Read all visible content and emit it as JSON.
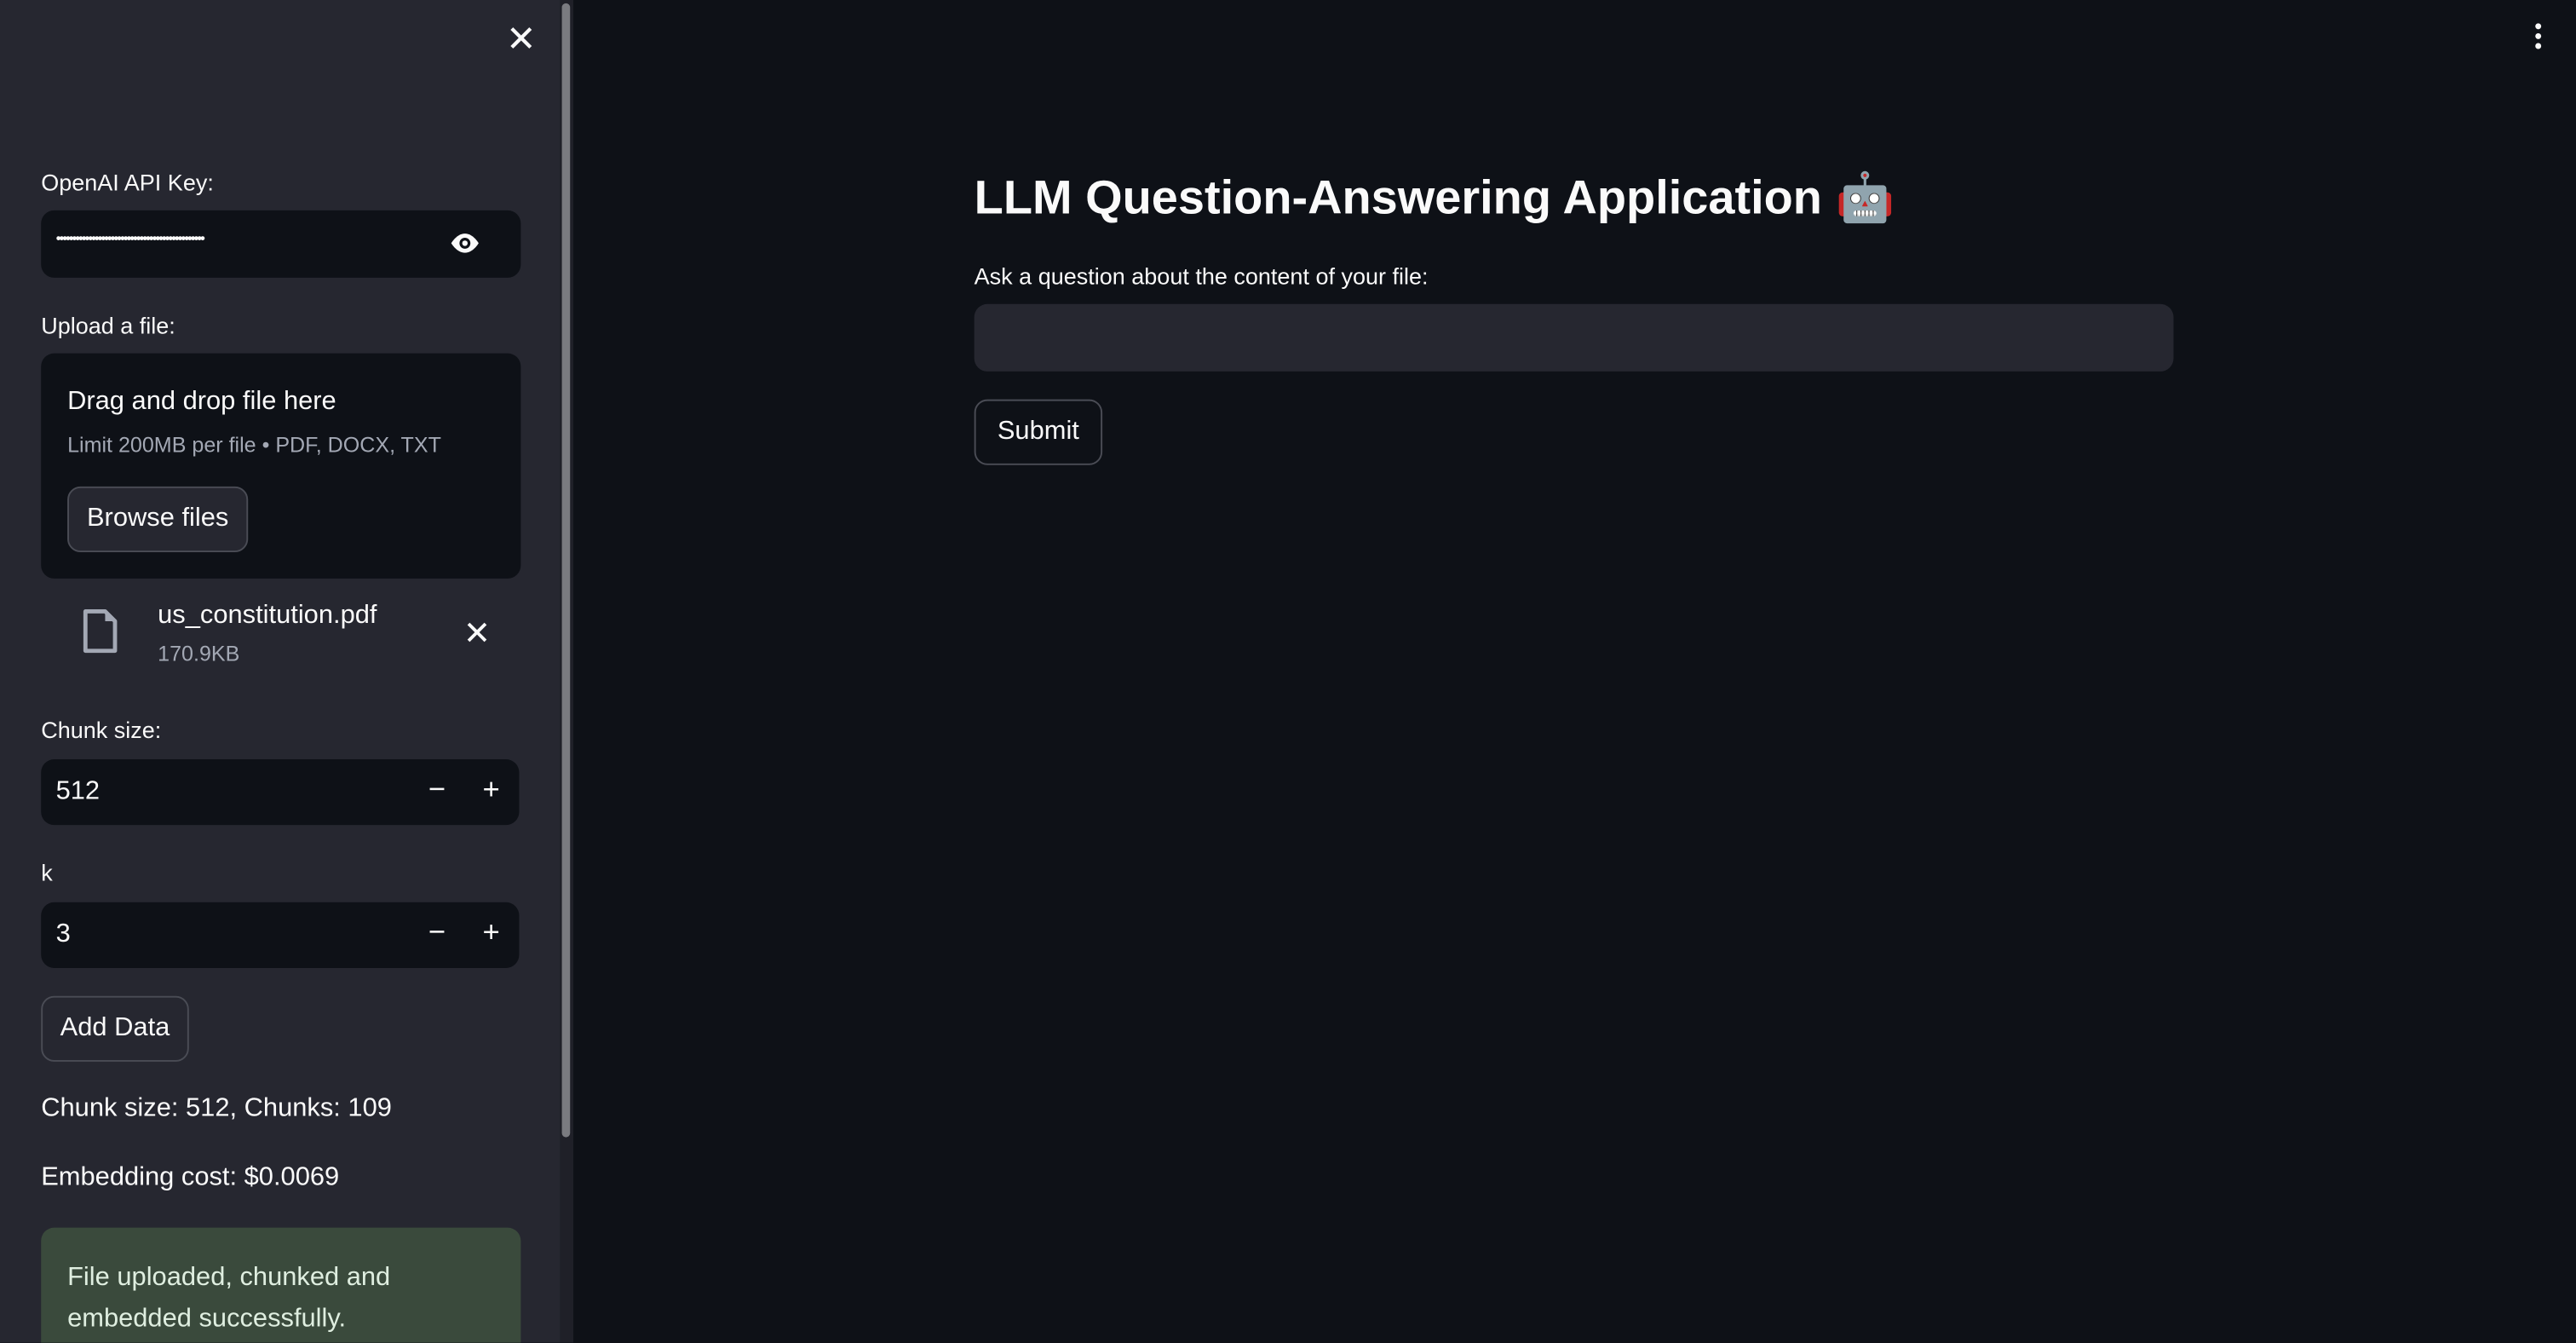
{
  "sidebar": {
    "api_key_label": "OpenAI API Key:",
    "api_key_value": "••••••••••••••••••••••••••••••••••••••••••••••",
    "upload_label": "Upload a file:",
    "dropzone_title": "Drag and drop file here",
    "dropzone_hint": "Limit 200MB per file • PDF, DOCX, TXT",
    "browse_label": "Browse files",
    "file": {
      "name": "us_constitution.pdf",
      "size": "170.9KB"
    },
    "chunk_label": "Chunk size:",
    "chunk_value": "512",
    "k_label": "k",
    "k_value": "3",
    "add_data_label": "Add Data",
    "chunk_info": "Chunk size: 512, Chunks: 109",
    "embedding_cost": "Embedding cost: $0.0069",
    "success_message": "File uploaded, chunked and embedded successfully.",
    "minus": "−",
    "plus": "+"
  },
  "main": {
    "title": "LLM Question-Answering Application",
    "title_emoji": "🤖",
    "question_label": "Ask a question about the content of your file:",
    "question_value": "",
    "submit_label": "Submit"
  },
  "colors": {
    "sidebar_bg": "#262730",
    "main_bg": "#0e1117",
    "success_bg": "#3a4a3c"
  }
}
